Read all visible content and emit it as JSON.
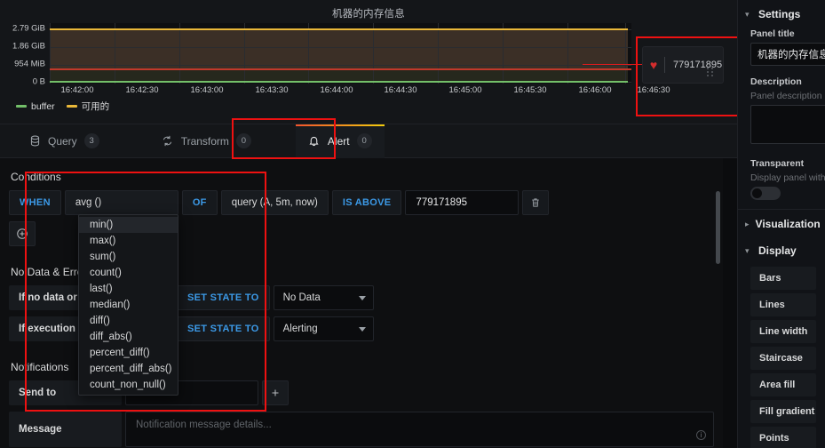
{
  "panel": {
    "title": "机器的内存信息",
    "alert_marker": {
      "icon": "broken-heart-icon",
      "value": "779171895"
    }
  },
  "chart_data": {
    "type": "line",
    "title": "机器的内存信息",
    "xlabel": "",
    "ylabel": "",
    "y_ticks": [
      "2.79 GiB",
      "1.86 GiB",
      "954 MiB",
      "0 B"
    ],
    "ylim": [
      0,
      2994
    ],
    "x_ticks": [
      "16:42:00",
      "16:42:30",
      "16:43:00",
      "16:43:30",
      "16:44:00",
      "16:44:30",
      "16:45:00",
      "16:45:30",
      "16:46:00",
      "16:46:30"
    ],
    "grid": true,
    "legend_position": "bottom-left",
    "series": [
      {
        "name": "buffer",
        "color": "#73bf69",
        "value_gib": 0.03,
        "values": [
          0.03,
          0.03,
          0.03,
          0.03,
          0.03,
          0.03,
          0.03,
          0.03,
          0.03,
          0.03
        ]
      },
      {
        "name": "可用的",
        "color": "#eab839",
        "value_gib": 2.79,
        "values": [
          2.79,
          2.79,
          2.79,
          2.79,
          2.79,
          2.79,
          2.79,
          2.79,
          2.79,
          2.79
        ]
      }
    ],
    "threshold": {
      "label": "IS ABOVE",
      "value": 779171895,
      "display_gib": 0.73,
      "color": "#c0392b"
    }
  },
  "tabs": [
    {
      "label": "Query",
      "count": "3",
      "icon": "database-icon",
      "active": false
    },
    {
      "label": "Transform",
      "count": "0",
      "icon": "transform-icon",
      "active": false
    },
    {
      "label": "Alert",
      "count": "0",
      "icon": "bell-icon",
      "active": true
    }
  ],
  "conditions": {
    "section_title": "Conditions",
    "when_label": "WHEN",
    "reducer_value": "avg ()",
    "of_label": "OF",
    "query_value": "query (A, 5m, now)",
    "evaluator_label": "IS ABOVE",
    "threshold_value": "779171895",
    "delete_icon": "trash-icon",
    "add_icon": "plus-circle-icon"
  },
  "reducer_dropdown": {
    "selected": "min()",
    "options": [
      "min()",
      "max()",
      "sum()",
      "count()",
      "last()",
      "median()",
      "diff()",
      "diff_abs()",
      "percent_diff()",
      "percent_diff_abs()",
      "count_non_null()"
    ]
  },
  "no_data": {
    "section_title": "No Data & Error Handling",
    "rows": [
      {
        "label": "If no data or all values are null",
        "action": "SET STATE TO",
        "state": "No Data"
      },
      {
        "label": "If execution error or timeout",
        "action": "SET STATE TO",
        "state": "Alerting"
      }
    ]
  },
  "notifications": {
    "section_title": "Notifications",
    "send_to_label": "Send to",
    "message_label": "Message",
    "message_placeholder": "Notification message details...",
    "info_icon": "info-icon"
  },
  "sidebar": {
    "settings": {
      "header": "Settings",
      "panel_title_label": "Panel title",
      "panel_title_value": "机器的内存信息",
      "description_label": "Description",
      "description_sub": "Panel description",
      "description_value": "",
      "transparent_label": "Transparent",
      "transparent_sub": "Display panel without",
      "transparent_on": false
    },
    "visualization": {
      "header": "Visualization",
      "expanded": false
    },
    "display": {
      "header": "Display",
      "expanded": true,
      "options": [
        "Bars",
        "Lines",
        "Line width",
        "Staircase",
        "Area fill",
        "Fill gradient",
        "Points"
      ]
    }
  },
  "colors": {
    "accent_blue": "#3c9ae8",
    "series_green": "#73bf69",
    "series_yellow": "#eab839",
    "threshold_red": "#c0392b",
    "annotation_red": "#ee1111",
    "tab_gradient_start": "#f2542d",
    "tab_gradient_end": "#f2cc0d"
  }
}
